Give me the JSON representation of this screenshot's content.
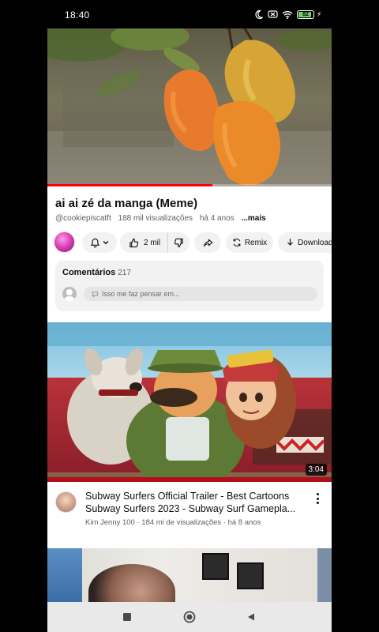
{
  "status_bar": {
    "time": "18:40",
    "battery_level": "82",
    "icons": [
      "moon-icon",
      "silent-icon",
      "wifi-icon",
      "battery-icon",
      "charging-icon"
    ]
  },
  "player": {
    "progress_fraction": 0.58
  },
  "video": {
    "title": "ai ai zé da manga (Meme)",
    "channel": "@cookiepiscatft",
    "views": "188 mil visualizações",
    "age": "há 4 anos",
    "more_label": "...mais"
  },
  "actions": {
    "likes": "2 mil",
    "remix_label": "Remix",
    "download_label": "Download"
  },
  "comments": {
    "header": "Comentários",
    "count": "217",
    "placeholder": "Isso me faz pensar em..."
  },
  "recommended": {
    "duration": "3:04",
    "title_line1": "Subway Surfers Official Trailer - Best Cartoons",
    "title_line2": "Subway Surfers 2023 - Subway Surf Gamepla...",
    "meta": "Kim Jenny 100 · 184 mi de visualizações · há 8 anos"
  },
  "colors": {
    "accent_red": "#ff0000",
    "pill_bg": "#f2f2f2",
    "text_primary": "#0f0f0f",
    "text_secondary": "#606060"
  }
}
